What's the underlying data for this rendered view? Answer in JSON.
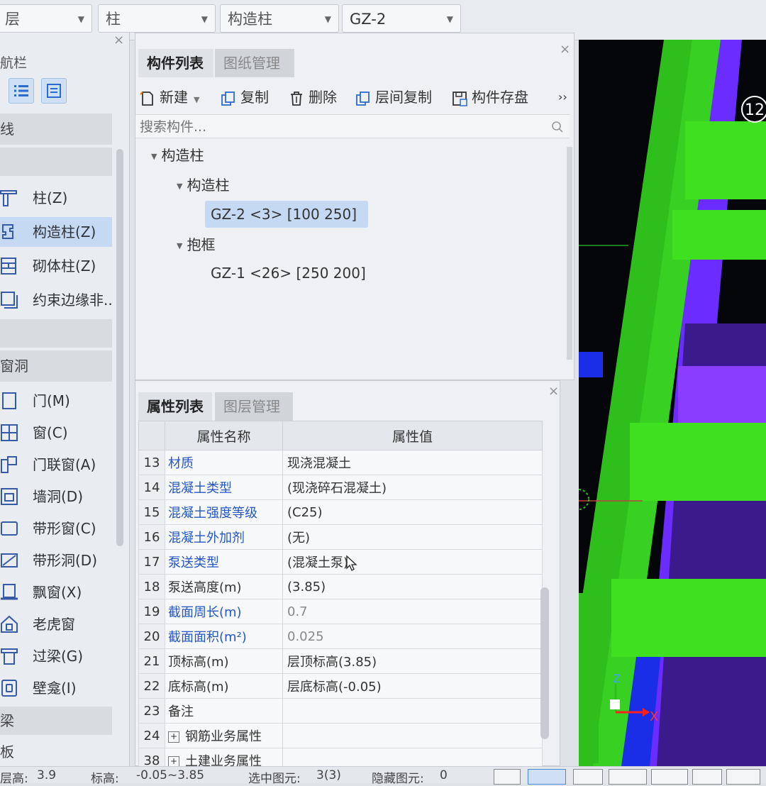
{
  "toolbar": {
    "floor_label": "层",
    "category": "柱",
    "subtype": "构造柱",
    "component": "GZ-2"
  },
  "nav": {
    "title": "航栏",
    "group1": "线",
    "group2": "窗洞",
    "group3": "梁",
    "group4": "板",
    "items": [
      {
        "label": "柱(Z)"
      },
      {
        "label": "构造柱(Z)"
      },
      {
        "label": "砌体柱(Z)"
      },
      {
        "label": "约束边缘非.."
      },
      {
        "label": "门(M)"
      },
      {
        "label": "窗(C)"
      },
      {
        "label": "门联窗(A)"
      },
      {
        "label": "墙洞(D)"
      },
      {
        "label": "带形窗(C)"
      },
      {
        "label": "带形洞(D)"
      },
      {
        "label": "飘窗(X)"
      },
      {
        "label": "老虎窗"
      },
      {
        "label": "过梁(G)"
      },
      {
        "label": "壁龛(I)"
      }
    ]
  },
  "comp_panel": {
    "tab_active": "构件列表",
    "tab_inactive": "图纸管理",
    "new": "新建",
    "copy": "复制",
    "delete": "删除",
    "floor_copy": "层间复制",
    "save": "构件存盘",
    "more": "››",
    "search_placeholder": "搜索构件...",
    "tree": {
      "root": "构造柱",
      "group1": "构造柱",
      "item1": "GZ-2 <3> [100 250]",
      "group2": "抱框",
      "item2": "GZ-1 <26> [250 200]"
    }
  },
  "prop_panel": {
    "tab_active": "属性列表",
    "tab_inactive": "图层管理",
    "col_name": "属性名称",
    "col_value": "属性值",
    "rows": [
      {
        "num": "13",
        "name": "材质",
        "value": "现浇混凝土"
      },
      {
        "num": "14",
        "name": "混凝土类型",
        "value": "(现浇碎石混凝土)"
      },
      {
        "num": "15",
        "name": "混凝土强度等级",
        "value": "(C25)"
      },
      {
        "num": "16",
        "name": "混凝土外加剂",
        "value": "(无)"
      },
      {
        "num": "17",
        "name": "泵送类型",
        "value": "(混凝土泵)"
      },
      {
        "num": "18",
        "name": "泵送高度(m)",
        "value": "(3.85)"
      },
      {
        "num": "19",
        "name": "截面周长(m)",
        "value": "0.7"
      },
      {
        "num": "20",
        "name": "截面面积(m²)",
        "value": "0.025"
      },
      {
        "num": "21",
        "name": "顶标高(m)",
        "value": "层顶标高(3.85)"
      },
      {
        "num": "22",
        "name": "底标高(m)",
        "value": "层底标高(-0.05)"
      },
      {
        "num": "23",
        "name": "备注",
        "value": ""
      },
      {
        "num": "24",
        "name": "钢筋业务属性",
        "value": ""
      },
      {
        "num": "38",
        "name": "土建业务属性",
        "value": ""
      }
    ]
  },
  "status": {
    "floor_height_label": "层高:",
    "floor_height": "3.9",
    "elev_label": "标高:",
    "elev": "-0.05~3.85",
    "selected_label": "选中图元:",
    "selected": "3(3)",
    "hidden_label": "隐藏图元:",
    "hidden": "0"
  },
  "viewport": {
    "axis_badge": "12",
    "axis_x": "X",
    "axis_z": "Z"
  },
  "colors": {
    "selection": "#c5daf2",
    "link_blue": "#2456c4",
    "viewport_bg": "#05060a",
    "green": "#2fbf1d",
    "bright_green": "#3fe01f",
    "purple": "#6a2cff",
    "dark_purple": "#3b1a8c",
    "blue": "#1a2ee8"
  }
}
